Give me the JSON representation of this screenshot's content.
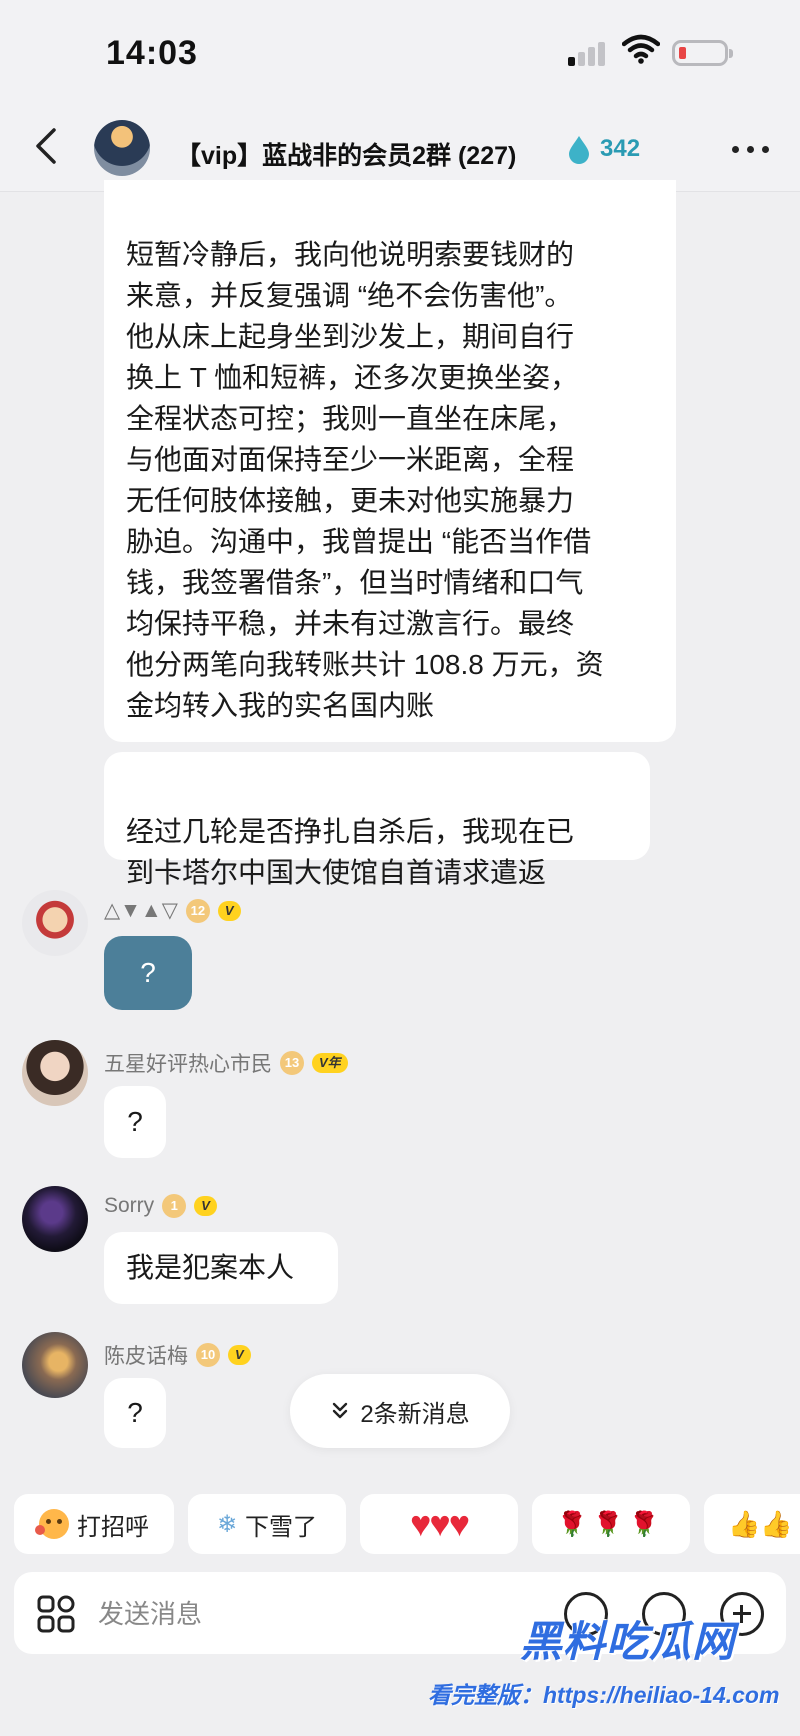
{
  "status": {
    "time": "14:03"
  },
  "header": {
    "title": "【vip】蓝战非的会员2群 (227)",
    "fire_count": "342",
    "colors": {
      "fire": "#2a9bb3"
    }
  },
  "messages": {
    "long_text": "短暂冷静后，我向他说明索要钱财的\n来意，并反复强调 “绝不会伤害他”。\n他从床上起身坐到沙发上，期间自行\n换上 T 恤和短裤，还多次更换坐姿，\n全程状态可控；我则一直坐在床尾，\n与他面对面保持至少一米距离，全程\n无任何肢体接触，更未对他实施暴力\n胁迫。沟通中，我曾提出 “能否当作借\n钱，我签署借条”，但当时情绪和口气\n均保持平稳，并未有过激言行。最终\n他分两笔向我转账共计 108.8 万元，资\n金均转入我的实名国内账",
    "followup_text": "经过几轮是否挣扎自杀后，我现在已\n到卡塔尔中国大使馆自首请求遣返",
    "items": [
      {
        "nick": "△▼▲▽",
        "level": "12",
        "badge": "V",
        "text": "?"
      },
      {
        "nick": "五星好评热心市民",
        "level": "13",
        "badge": "V年",
        "text": "?"
      },
      {
        "nick": "Sorry",
        "level": "1",
        "badge": "V",
        "text": "我是犯案本人"
      },
      {
        "nick": "陈皮话梅",
        "level": "10",
        "badge": "V",
        "text": "?"
      }
    ]
  },
  "new_messages": {
    "label": "2条新消息"
  },
  "quick_replies": [
    {
      "label": "打招呼",
      "icon": "wave-face-icon"
    },
    {
      "label": "下雪了",
      "icon": "snowflake-icon"
    },
    {
      "label": "♥♥♥",
      "icon": "hearts-icon"
    },
    {
      "label": "🌹🌹🌹",
      "icon": "roses-icon"
    },
    {
      "label": "👍👍",
      "icon": "thumbs-up-icon"
    }
  ],
  "input": {
    "placeholder": "发送消息"
  },
  "watermark": {
    "logo": "黑料吃瓜网",
    "url": "看完整版：https://heiliao-14.com"
  }
}
